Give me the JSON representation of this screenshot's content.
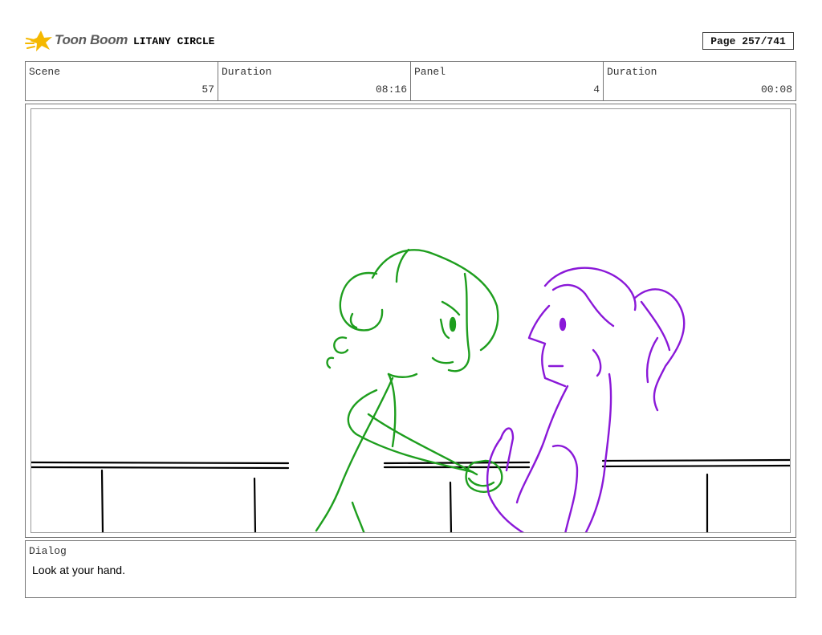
{
  "header": {
    "logo_text": "Toon Boom",
    "project_title": "LITANY CIRCLE",
    "page_label": "Page 257/741"
  },
  "info": {
    "scene_label": "Scene",
    "scene_value": "57",
    "scene_duration_label": "Duration",
    "scene_duration_value": "08:16",
    "panel_label": "Panel",
    "panel_value": "4",
    "panel_duration_label": "Duration",
    "panel_duration_value": "00:08"
  },
  "dialog": {
    "label": "Dialog",
    "text": "Look at your hand."
  },
  "colors": {
    "logo_star": "#f5b800",
    "character_left": "#1e9e1e",
    "character_right": "#8a18d8",
    "railing": "#000000",
    "border": "#777777"
  }
}
